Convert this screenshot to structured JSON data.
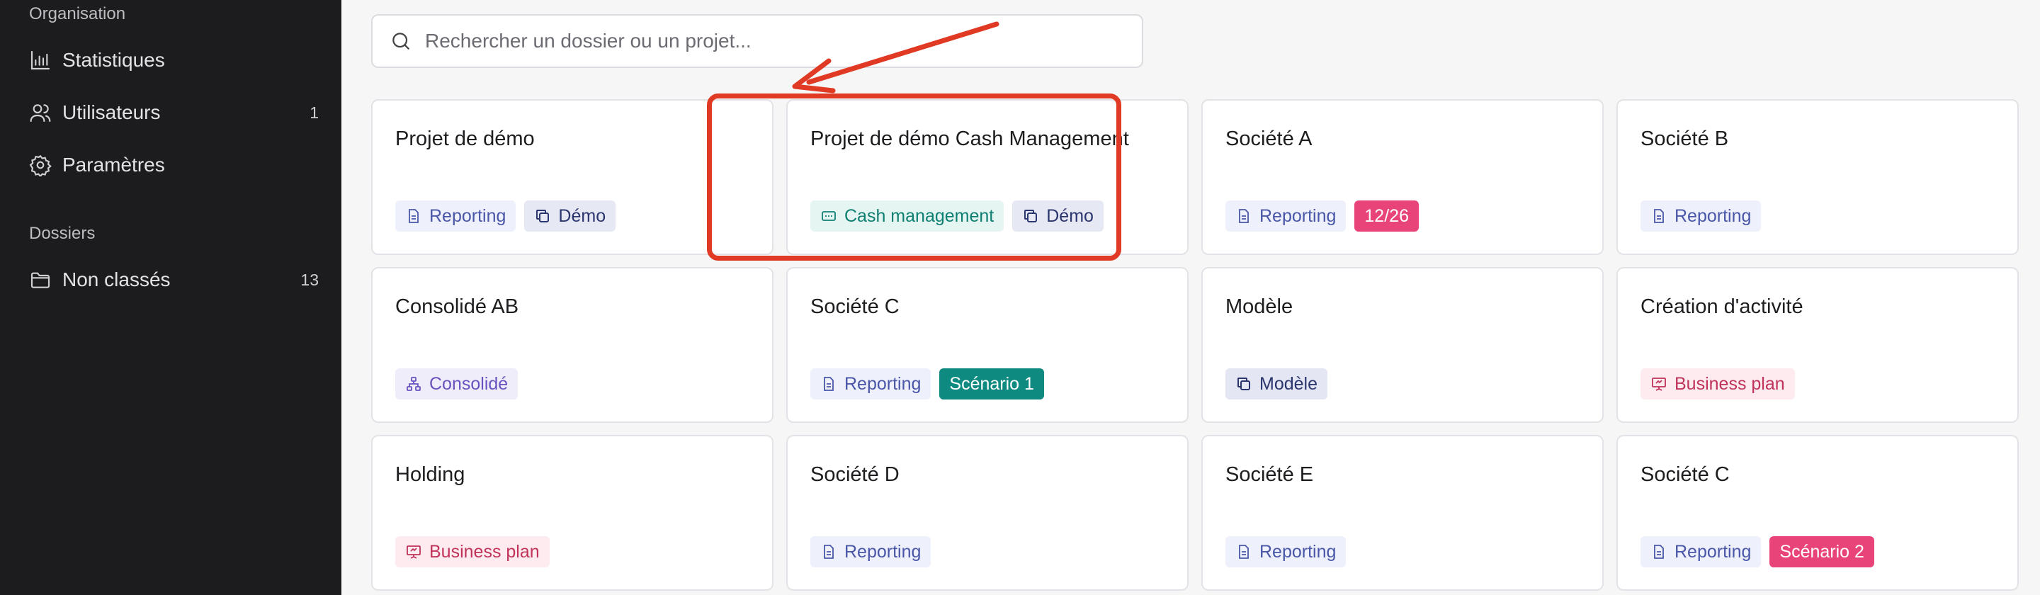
{
  "sidebar": {
    "org_section": "Organisation",
    "items": [
      {
        "label": "Statistiques",
        "icon": "bar-chart-icon",
        "count": ""
      },
      {
        "label": "Utilisateurs",
        "icon": "users-icon",
        "count": "1"
      },
      {
        "label": "Paramètres",
        "icon": "gear-icon",
        "count": ""
      }
    ],
    "folders_section": "Dossiers",
    "folders": [
      {
        "label": "Non classés",
        "icon": "folder-icon",
        "count": "13"
      }
    ]
  },
  "search": {
    "placeholder": "Rechercher un dossier ou un projet..."
  },
  "cards": [
    {
      "title": "Projet de démo",
      "tags": [
        {
          "label": "Reporting",
          "icon": "document-icon"
        },
        {
          "label": "Démo",
          "icon": "copy-icon"
        }
      ]
    },
    {
      "title": "Projet de démo Cash Management",
      "tags": [
        {
          "label": "Cash management",
          "icon": "cash-icon"
        },
        {
          "label": "Démo",
          "icon": "copy-icon"
        }
      ]
    },
    {
      "title": "Société A",
      "tags": [
        {
          "label": "Reporting",
          "icon": "document-icon"
        },
        {
          "label": "12/26"
        }
      ]
    },
    {
      "title": "Société B",
      "tags": [
        {
          "label": "Reporting",
          "icon": "document-icon"
        }
      ]
    },
    {
      "title": "Consolidé AB",
      "tags": [
        {
          "label": "Consolidé",
          "icon": "hierarchy-icon"
        }
      ]
    },
    {
      "title": "Société C",
      "tags": [
        {
          "label": "Reporting",
          "icon": "document-icon"
        },
        {
          "label": "Scénario 1"
        }
      ]
    },
    {
      "title": "Modèle",
      "tags": [
        {
          "label": "Modèle",
          "icon": "copy-icon"
        }
      ]
    },
    {
      "title": "Création d'activité",
      "tags": [
        {
          "label": "Business plan",
          "icon": "presentation-icon"
        }
      ]
    },
    {
      "title": "Holding",
      "tags": [
        {
          "label": "Business plan",
          "icon": "presentation-icon"
        }
      ]
    },
    {
      "title": "Société D",
      "tags": [
        {
          "label": "Reporting",
          "icon": "document-icon"
        }
      ]
    },
    {
      "title": "Société E",
      "tags": [
        {
          "label": "Reporting",
          "icon": "document-icon"
        }
      ]
    },
    {
      "title": "Société C",
      "tags": [
        {
          "label": "Reporting",
          "icon": "document-icon"
        },
        {
          "label": "Scénario 2"
        }
      ]
    }
  ],
  "colors": {
    "sidebar_bg": "#1c1c1e",
    "highlight": "#e03a24",
    "pink_badge": "#e8447a",
    "teal_badge": "#0f8a80"
  }
}
